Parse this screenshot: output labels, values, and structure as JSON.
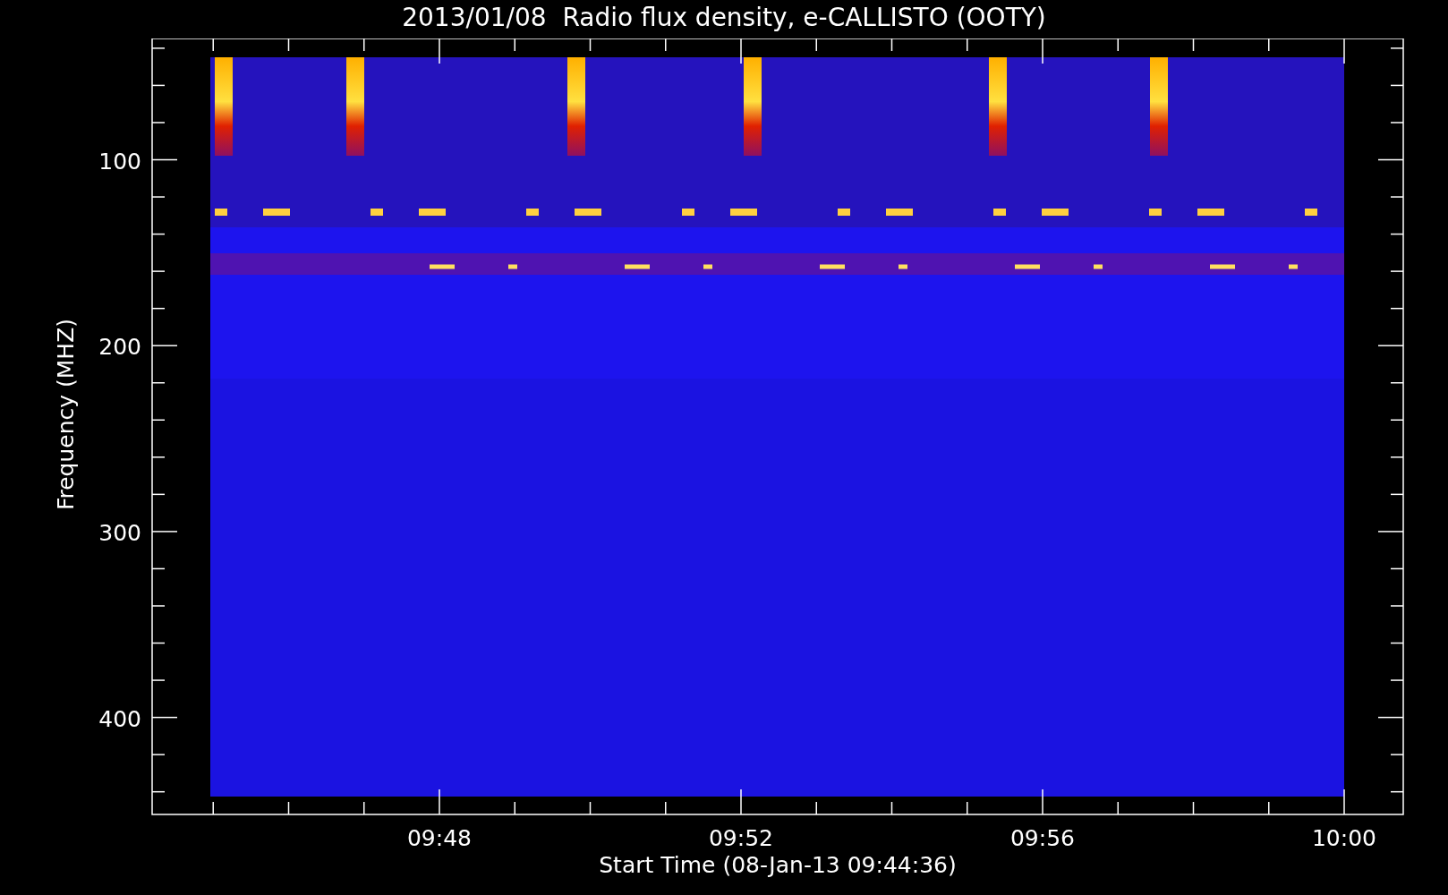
{
  "plot": {
    "title": "2013/01/08  Radio flux density, e-CALLISTO (OOTY)",
    "ylabel": "Frequency (MHZ)",
    "xlabel": "Start Time (08-Jan-13 09:44:36)",
    "yticks": [
      "100",
      "200",
      "300",
      "400"
    ],
    "xticks": [
      "09:48",
      "09:52",
      "09:56",
      "10:00"
    ]
  }
}
